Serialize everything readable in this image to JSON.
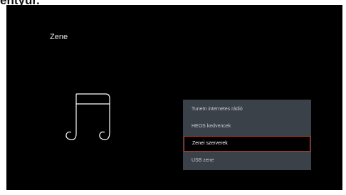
{
  "page": {
    "heading": "entyűr."
  },
  "screen": {
    "title": "Zene",
    "icon": "music-note-icon",
    "menu": {
      "items": [
        {
          "label": "TuneIn internetes rádió",
          "selected": false
        },
        {
          "label": "HEOS kedvencek",
          "selected": false
        },
        {
          "label": "Zenei szerverek",
          "selected": true
        },
        {
          "label": "USB zene",
          "selected": false
        }
      ],
      "selected_index": 2
    }
  },
  "colors": {
    "screen_background": "#000000",
    "menu_background": "#3b4148",
    "selection_border": "#c0392b",
    "menu_text": "#c8ccd1"
  }
}
